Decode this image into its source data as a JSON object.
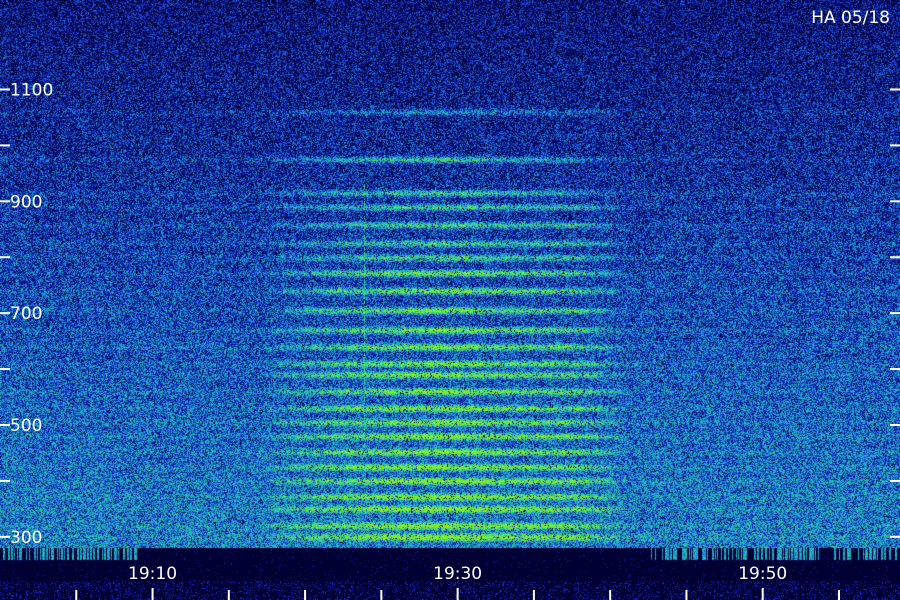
{
  "chart_data": {
    "type": "heatmap",
    "title": "HA 05/18",
    "xlabel": "",
    "ylabel": "",
    "y_tick_labels": [
      "1100",
      "900",
      "700",
      "500",
      "300"
    ],
    "y_tick_values": [
      1100,
      900,
      700,
      500,
      300
    ],
    "y_minor_tick_values": [
      1000,
      800,
      600,
      400
    ],
    "ylim": [
      280,
      1260
    ],
    "x_tick_labels": [
      "19:10",
      "19:30",
      "19:50"
    ],
    "x_tick_values": [
      "19:10",
      "19:30",
      "19:50"
    ],
    "x_minor_tick_values": [
      "19:05",
      "19:15",
      "19:20",
      "19:25",
      "19:35",
      "19:40",
      "19:45",
      "19:55"
    ],
    "xlim": [
      "19:00",
      "19:59"
    ],
    "grid": false,
    "colormap": [
      "#000033",
      "#1a2ad0",
      "#1fa0d0",
      "#2cd0a0",
      "#88f020"
    ],
    "signal": {
      "start": "19:20",
      "end": "19:38",
      "bands": [
        1060,
        975,
        915,
        890,
        858,
        825,
        800,
        772,
        740,
        705,
        670,
        640,
        610,
        590,
        560,
        530,
        505,
        480,
        452,
        425,
        400,
        372,
        350,
        320,
        300
      ]
    }
  }
}
